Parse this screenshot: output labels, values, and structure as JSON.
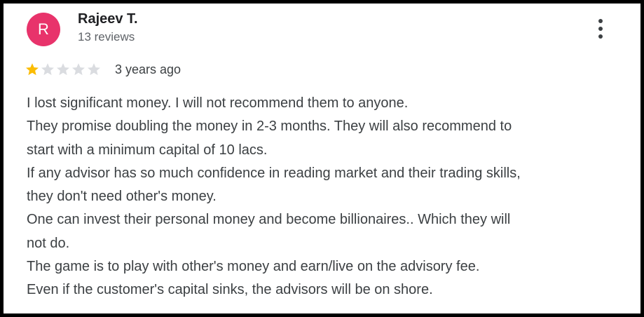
{
  "review": {
    "avatar_letter": "R",
    "avatar_color": "#e8336b",
    "reviewer_name": "Rajeev T.",
    "review_count": "13 reviews",
    "rating": 1,
    "max_rating": 5,
    "star_filled_color": "#fbbc04",
    "star_empty_color": "#dadce0",
    "date": "3 years ago",
    "more_icon": "more-vertical-icon",
    "lines": [
      "I lost significant money. I will not recommend them to anyone.",
      "They promise doubling the money in 2-3 months. They will also recommend to",
      "start with a minimum capital of 10 lacs.",
      "If any advisor has so much confidence in reading market and their trading skills,",
      "they don't need other's money.",
      "One can invest their personal money and become billionaires.. Which they will",
      "not do.",
      "The game is to play with other's money and earn/live on the advisory fee.",
      "Even if the customer's capital sinks, the advisors will be on shore."
    ]
  }
}
